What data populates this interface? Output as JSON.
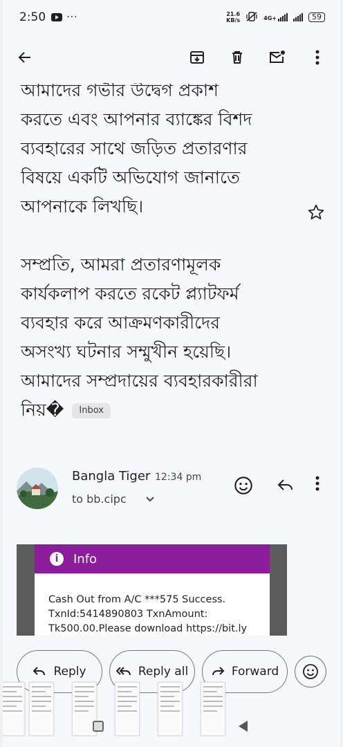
{
  "status_bar": {
    "time": "2:50",
    "more": "···",
    "net_speed_value": "21.6",
    "net_speed_unit": "KB/s",
    "network_type": "4G+",
    "battery": "59"
  },
  "toolbar": {
    "icons": [
      "back-arrow-icon",
      "archive-icon",
      "delete-icon",
      "mark-unread-icon",
      "more-vert-icon"
    ]
  },
  "email": {
    "lines": [
      "আমাদের গভীর উদ্বেগ প্রকাশ",
      "করতে এবং আপনার ব্যাঙ্কের বিশদ",
      "ব্যবহারের সাথে জড়িত প্রতারণার",
      "বিষয়ে একটি অভিযোগ জানাতে",
      "আপনাকে লিখছি।"
    ],
    "lines2": [
      "সম্প্রতি, আমরা প্রতারণামূলক",
      "কার্যকলাপ করতে রকেট প্ল্যাটফর্ম",
      "ব্যবহার করে আক্রমণকারীদের",
      "অসংখ্য ঘটনার সম্মুখীন হয়েছি।",
      "আমাদের সম্প্রদায়ের ব্যবহারকারীরা"
    ],
    "last_line": "নিয়�",
    "label_chip": "Inbox"
  },
  "sender": {
    "name": "Bangla Tiger",
    "time": "12:34 pm",
    "to": "to bb.cipc"
  },
  "embedded_image": {
    "header": "Info",
    "message_lines": [
      "Cash Out from A/C ***575 Success.",
      "TxnId:5414890803 TxnAmount:",
      "Tk500.00.Please download https://bit.ly"
    ]
  },
  "actions": {
    "reply": "Reply",
    "reply_all": "Reply all",
    "forward": "Forward"
  },
  "colors": {
    "background": "#f5f8fd",
    "embed_header": "#8c1d9a",
    "chip": "#e4e6eb"
  }
}
